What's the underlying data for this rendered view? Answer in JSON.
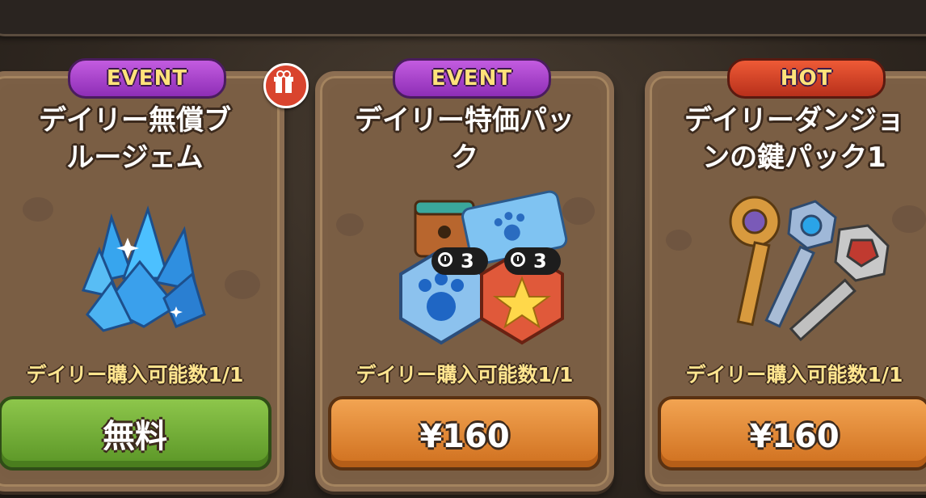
{
  "cards": [
    {
      "badge": "EVENT",
      "title": "デイリー無償ブ\nルージェム",
      "limit": "デイリー購入可能数1/1",
      "button": "無料",
      "item_icon": "blue-gem-cluster-icon",
      "has_gift": true
    },
    {
      "badge": "EVENT",
      "title": "デイリー特価パッ\nク",
      "limit": "デイリー購入可能数1/1",
      "button": "¥160",
      "item_icon": "bundle-icon",
      "timer_a": "3",
      "timer_b": "3"
    },
    {
      "badge": "HOT",
      "title": "デイリーダンジョ\nンの鍵パック1",
      "limit": "デイリー購入可能数1/1",
      "button": "¥160",
      "item_icon": "keys-icon"
    }
  ],
  "colors": {
    "event_badge": "#a43fce",
    "hot_badge": "#d8411f",
    "free_button": "#6ea834",
    "price_button": "#e08a35"
  }
}
